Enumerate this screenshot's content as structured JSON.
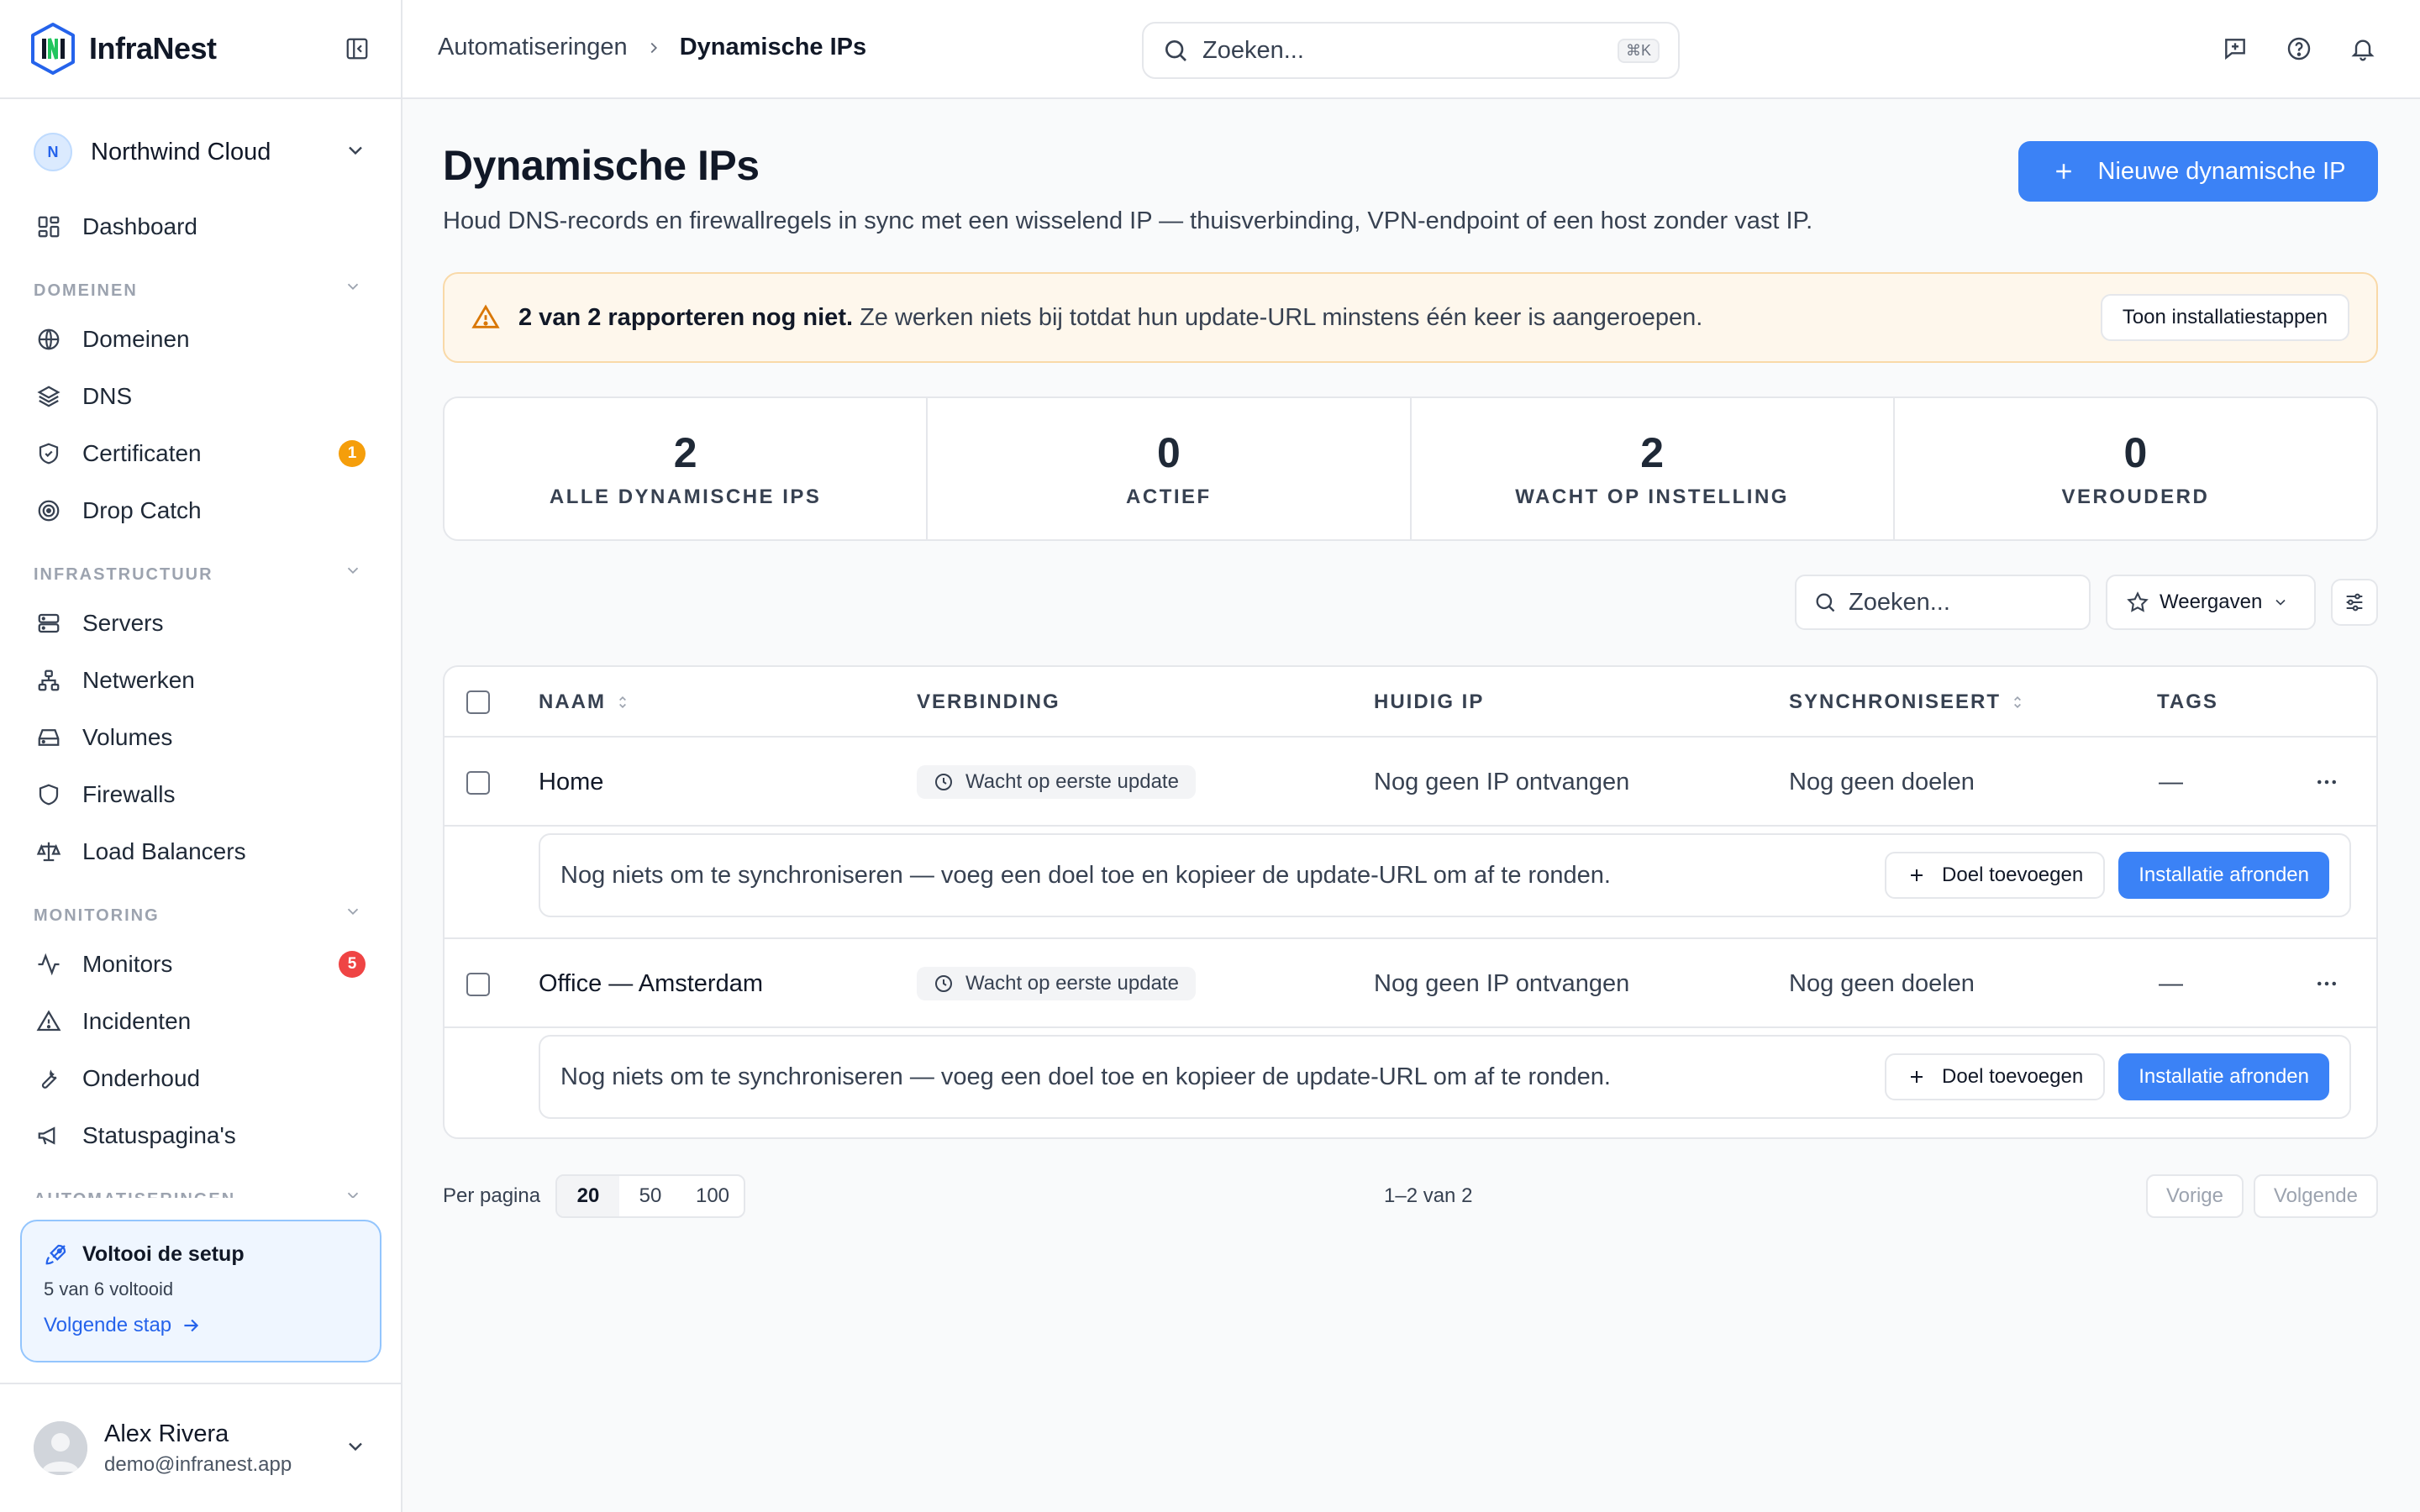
{
  "app": {
    "name": "InfraNest",
    "brand_color": "#3b82f6"
  },
  "workspace": {
    "initial": "N",
    "name": "Northwind Cloud"
  },
  "nav": {
    "dashboard": "Dashboard",
    "sections": {
      "domeinen": "DOMEINEN",
      "infrastructuur": "INFRASTRUCTUUR",
      "monitoring": "MONITORING",
      "automatiseringen": "AUTOMATISERINGEN"
    },
    "items": {
      "domeinen": "Domeinen",
      "dns": "DNS",
      "certificaten": "Certificaten",
      "drop_catch": "Drop Catch",
      "servers": "Servers",
      "netwerken": "Netwerken",
      "volumes": "Volumes",
      "firewalls": "Firewalls",
      "load_balancers": "Load Balancers",
      "monitors": "Monitors",
      "incidenten": "Incidenten",
      "onderhoud": "Onderhoud",
      "statuspaginas": "Statuspagina's"
    },
    "badges": {
      "certificaten": "1",
      "monitors": "5"
    },
    "badge_colors": {
      "warning": "#f59e0b",
      "danger": "#ef4444"
    }
  },
  "setup": {
    "title": "Voltooi de setup",
    "progress": "5 van 6 voltooid",
    "link": "Volgende stap"
  },
  "user": {
    "name": "Alex Rivera",
    "email": "demo@infranest.app"
  },
  "header": {
    "breadcrumb_parent": "Automatiseringen",
    "breadcrumb_current": "Dynamische IPs",
    "search_placeholder": "Zoeken...",
    "search_shortcut": "⌘K"
  },
  "page": {
    "title": "Dynamische IPs",
    "description": "Houd DNS-records en firewallregels in sync met een wisselend IP — thuisverbinding, VPN-endpoint of een host zonder vast IP.",
    "new_button": "Nieuwe dynamische IP"
  },
  "alert": {
    "bold": "2 van 2 rapporteren nog niet.",
    "text": " Ze werken niets bij totdat hun update-URL minstens één keer is aangeroepen.",
    "button": "Toon installatiestappen"
  },
  "stats": [
    {
      "value": "2",
      "label": "ALLE DYNAMISCHE IPS"
    },
    {
      "value": "0",
      "label": "ACTIEF"
    },
    {
      "value": "2",
      "label": "WACHT OP INSTELLING"
    },
    {
      "value": "0",
      "label": "VEROUDERD"
    }
  ],
  "filters": {
    "search_placeholder": "Zoeken...",
    "views_label": "Weergaven"
  },
  "table": {
    "columns": {
      "naam": "NAAM",
      "verbinding": "VERBINDING",
      "huidig_ip": "HUIDIG IP",
      "synchroniseert": "SYNCHRONISEERT",
      "tags": "TAGS"
    },
    "rows": [
      {
        "name": "Home",
        "connection": "Wacht op eerste update",
        "current_ip": "Nog geen IP ontvangen",
        "sync": "Nog geen doelen",
        "tags": "—",
        "hint": "Nog niets om te synchroniseren — voeg een doel toe en kopieer de update-URL om af te ronden.",
        "add_target": "Doel toevoegen",
        "finish": "Installatie afronden"
      },
      {
        "name": "Office — Amsterdam",
        "connection": "Wacht op eerste update",
        "current_ip": "Nog geen IP ontvangen",
        "sync": "Nog geen doelen",
        "tags": "—",
        "hint": "Nog niets om te synchroniseren — voeg een doel toe en kopieer de update-URL om af te ronden.",
        "add_target": "Doel toevoegen",
        "finish": "Installatie afronden"
      }
    ]
  },
  "pagination": {
    "per_page_label": "Per pagina",
    "options": [
      "20",
      "50",
      "100"
    ],
    "selected": "20",
    "range": "1–2 van 2",
    "prev": "Vorige",
    "next": "Volgende"
  }
}
